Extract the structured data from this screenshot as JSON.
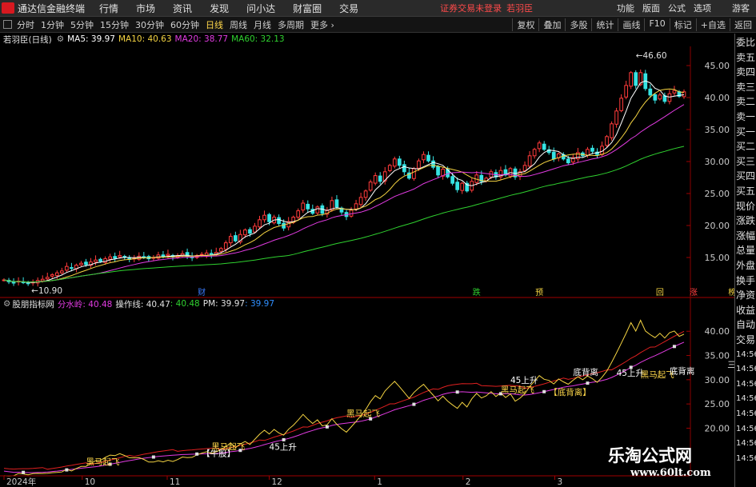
{
  "menubar": {
    "app_title": "通达信金融终端",
    "items": [
      "行情",
      "市场",
      "资讯",
      "发现",
      "问小达",
      "财富圈",
      "交易"
    ],
    "warning": "证券交易未登录",
    "username": "若羽臣",
    "right_items": [
      "功能",
      "版面",
      "公式",
      "选项"
    ],
    "guest": "游客"
  },
  "toolbar": {
    "periods": [
      "分时",
      "1分钟",
      "5分钟",
      "15分钟",
      "30分钟",
      "60分钟",
      "日线",
      "周线",
      "月线",
      "多周期",
      "更多 ›"
    ],
    "active_period": "日线",
    "right_buttons": [
      "复权",
      "叠加",
      "多股",
      "统计",
      "画线",
      "F10",
      "标记",
      "+自选",
      "返回"
    ]
  },
  "price_header": {
    "stock": "若羽臣(日线)",
    "ma": [
      {
        "label": "MA5: 39.97",
        "color": "#ffffff"
      },
      {
        "label": "MA10: 40.63",
        "color": "#f5d442"
      },
      {
        "label": "MA20: 38.77",
        "color": "#e23be2"
      },
      {
        "label": "MA60: 32.13",
        "color": "#2fd12f"
      }
    ]
  },
  "indicator_header": {
    "name": "股朋指标网",
    "items": [
      {
        "label": "分水岭: 40.48",
        "color": "#e23be2"
      },
      {
        "label": "操作线: 40.47",
        "color": "#e0e0e0"
      },
      {
        "label": ": 40.48",
        "color": "#2fd12f"
      },
      {
        "label": "PM: 39.97",
        "color": "#e0e0e0"
      },
      {
        "label": ": 39.97",
        "color": "#2f8fff"
      }
    ]
  },
  "sidebar_items": [
    "委比",
    "卖五",
    "卖四",
    "卖三",
    "卖二",
    "卖一",
    "买一",
    "买二",
    "买三",
    "买四",
    "买五",
    "现价",
    "涨跌",
    "涨幅",
    "总量",
    "外盘",
    "换手",
    "净资",
    "收益",
    "自动",
    "交易",
    "14:56",
    "14:56",
    "14:56",
    "14:56",
    "14:56",
    "14:56",
    "14:56",
    "14:56"
  ],
  "chart_data": [
    {
      "type": "candlestick",
      "title": "若羽臣(日线)",
      "y_ticks": [
        15,
        20,
        25,
        30,
        35,
        40,
        45
      ],
      "ylim": [
        9,
        48
      ],
      "high_label": "46.60",
      "low_label": "10.90",
      "closes": [
        11.5,
        11.2,
        11.0,
        11.3,
        11.1,
        10.9,
        11.2,
        11.4,
        11.6,
        11.9,
        12.3,
        12.6,
        12.9,
        13.6,
        13.3,
        13.8,
        14.1,
        13.9,
        14.3,
        14.6,
        14.4,
        14.8,
        15.1,
        14.9,
        15.3,
        15.0,
        14.7,
        14.9,
        15.2,
        15.1,
        14.8,
        15.0,
        15.4,
        15.2,
        15.5,
        15.1,
        15.3,
        15.6,
        15.2,
        15.0,
        15.3,
        15.5,
        15.7,
        15.4,
        15.8,
        16.4,
        17.3,
        18.3,
        17.6,
        18.6,
        19.3,
        18.8,
        19.9,
        20.9,
        21.6,
        20.6,
        21.3,
        20.3,
        19.6,
        20.6,
        21.3,
        22.3,
        23.5,
        22.6,
        21.9,
        22.9,
        21.9,
        22.4,
        23.9,
        22.9,
        22.1,
        21.4,
        22.4,
        23.4,
        24.4,
        25.4,
        26.8,
        27.8,
        26.9,
        28.4,
        29.4,
        30.4,
        29.4,
        28.4,
        27.4,
        28.9,
        30.1,
        31.1,
        30.1,
        29.1,
        27.9,
        28.8,
        27.6,
        26.6,
        25.6,
        26.6,
        25.4,
        26.9,
        27.9,
        26.9,
        27.4,
        28.4,
        27.6,
        28.6,
        27.9,
        28.9,
        27.6,
        28.4,
        29.4,
        30.9,
        31.9,
        32.9,
        31.9,
        31.4,
        30.4,
        31.2,
        30.4,
        29.8,
        30.6,
        31.4,
        30.9,
        31.9,
        31.6,
        31.1,
        32.4,
        33.9,
        35.9,
        37.9,
        39.9,
        41.9,
        43.9,
        41.9,
        43.9,
        41.4,
        40.4,
        39.6,
        40.4,
        39.4,
        40.6,
        41.1,
        40.2,
        40.9
      ],
      "ma5": 39.97,
      "ma10": 40.63,
      "ma20": 38.77,
      "ma60": 32.13,
      "markers": [
        {
          "label": "财",
          "color": "#3a7bff",
          "index": 41
        },
        {
          "label": "跌",
          "color": "#2fd12f",
          "index": 98
        },
        {
          "label": "预",
          "color": "#f5d442",
          "index": 111
        },
        {
          "label": "回",
          "color": "#f5d442",
          "index": 136
        },
        {
          "label": "涨",
          "color": "#ff4040",
          "index": 143
        },
        {
          "label": "榜",
          "color": "#f5d442",
          "index": 151
        },
        {
          "label": "减",
          "color": "#2fd12f",
          "index": 161
        }
      ]
    },
    {
      "type": "line",
      "title": "股朋指标网",
      "y_ticks": [
        20,
        25,
        30,
        35,
        40
      ],
      "ylim": [
        11,
        44
      ],
      "x_ticks": [
        "2024年",
        "10",
        "11",
        "12",
        "1",
        "2",
        "3"
      ],
      "series": [
        {
          "name": "分水岭",
          "color": "#e23be2"
        },
        {
          "name": "操作线",
          "color": "#e0e0e0"
        },
        {
          "name": "PM",
          "color": "#e0e0e0"
        }
      ],
      "annotations": [
        {
          "text": "黑马起飞",
          "color": "#ffd84a",
          "x_index": 17,
          "value": 12.5
        },
        {
          "text": "【牛股】",
          "color": "#ffffff",
          "x_index": 41,
          "value": 14.2
        },
        {
          "text": "黑马起飞",
          "color": "#ffd84a",
          "x_index": 43,
          "value": 15.6
        },
        {
          "text": "45上升",
          "color": "#ffffff",
          "x_index": 55,
          "value": 15.5
        },
        {
          "text": "黑马起飞",
          "color": "#ffd84a",
          "x_index": 71,
          "value": 22.5
        },
        {
          "text": "黑马起飞",
          "color": "#ffd84a",
          "x_index": 103,
          "value": 27.3
        },
        {
          "text": "【底背离】",
          "color": "#ffd84a",
          "x_index": 113,
          "value": 26.8
        },
        {
          "text": "45上升",
          "color": "#ffffff",
          "x_index": 105,
          "value": 29.3
        },
        {
          "text": "底背离",
          "color": "#ffffff",
          "x_index": 118,
          "value": 31.0
        },
        {
          "text": "45上升",
          "color": "#ffffff",
          "x_index": 127,
          "value": 30.8
        },
        {
          "text": "黑马起飞",
          "color": "#ffd84a",
          "x_index": 132,
          "value": 30.5
        },
        {
          "text": "底背离",
          "color": "#ffffff",
          "x_index": 138,
          "value": 31.2
        },
        {
          "text": "三底背离",
          "color": "#ffffff",
          "x_index": 150,
          "value": 32.5
        },
        {
          "text": "黑马起飞",
          "color": "#ffd84a",
          "x_index": 165,
          "value": 38.3
        },
        {
          "text": "三底背",
          "color": "#ffffff",
          "x_index": 169,
          "value": 41.0
        }
      ]
    }
  ],
  "watermark": {
    "text1": "乐淘公式网",
    "text2": "www.60lt.com"
  }
}
